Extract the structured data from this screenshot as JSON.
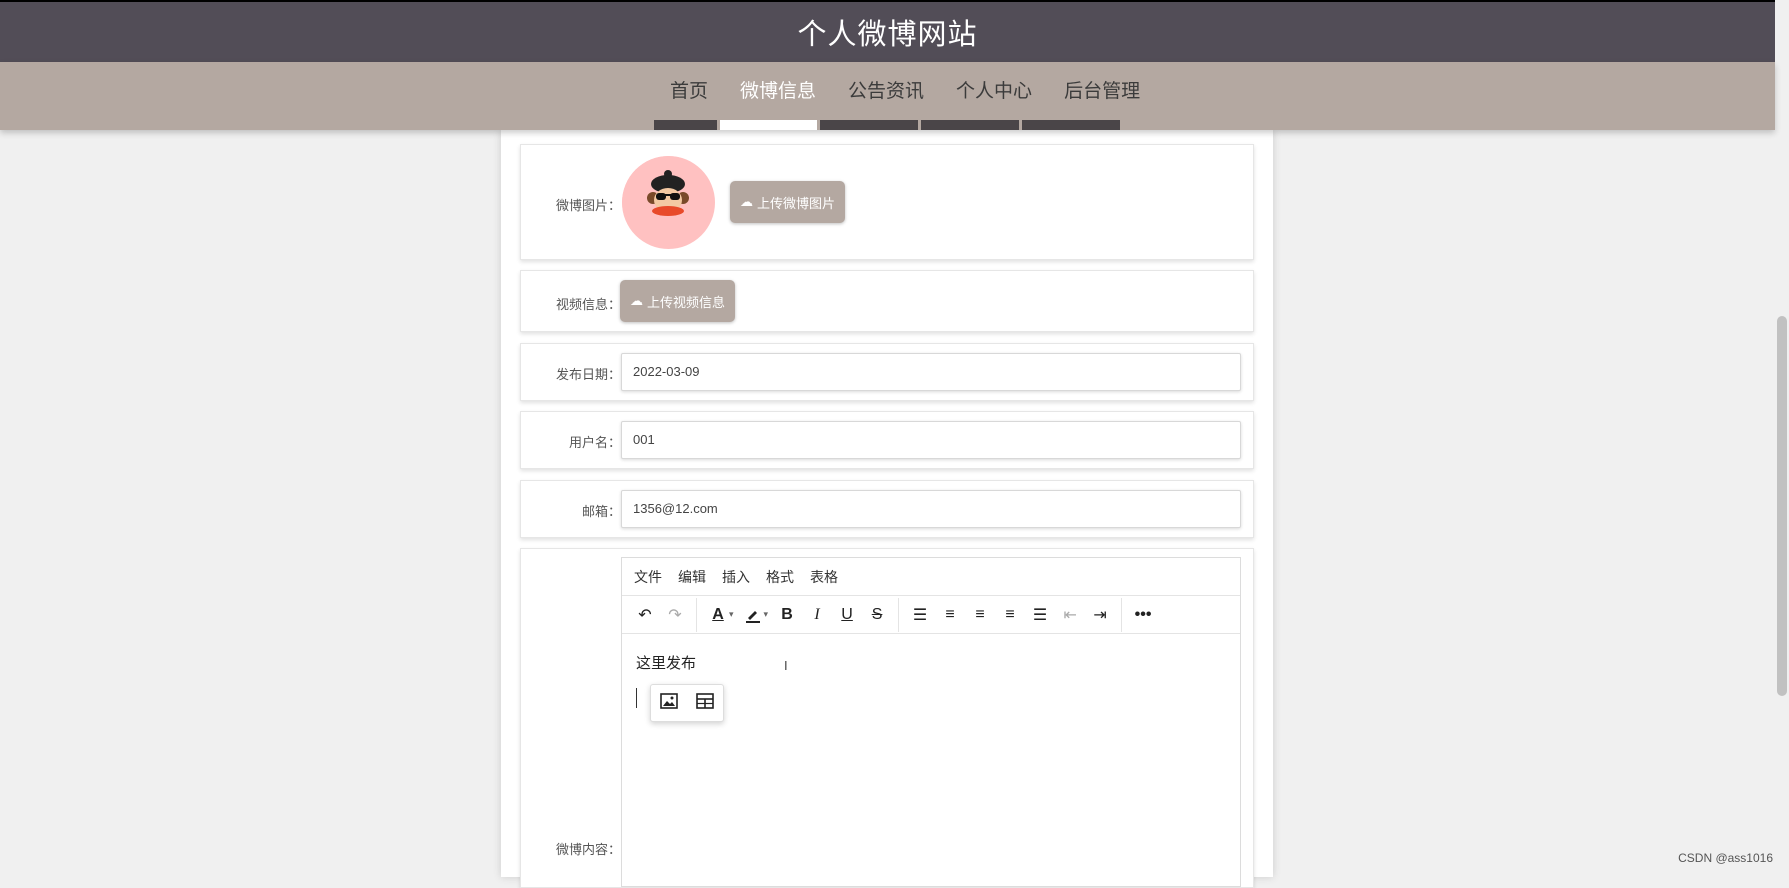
{
  "site": {
    "title": "个人微博网站"
  },
  "nav": {
    "items": [
      {
        "label": "首页"
      },
      {
        "label": "微博信息"
      },
      {
        "label": "公告资讯"
      },
      {
        "label": "个人中心"
      },
      {
        "label": "后台管理"
      }
    ],
    "active_index": 1
  },
  "form": {
    "image": {
      "label": "微博图片：",
      "upload_label": "上传微博图片"
    },
    "video": {
      "label": "视频信息：",
      "upload_label": "上传视频信息"
    },
    "publish_date": {
      "label": "发布日期：",
      "value": "2022-03-09"
    },
    "username": {
      "label": "用户名：",
      "value": "001"
    },
    "email": {
      "label": "邮箱：",
      "value": "1356@12.com"
    },
    "content": {
      "label": "微博内容：",
      "menu": [
        "文件",
        "编辑",
        "插入",
        "格式",
        "表格"
      ],
      "text": "这里发布"
    }
  },
  "toolbar_icons": [
    "undo-icon",
    "redo-icon",
    "text-color-icon",
    "highlight-icon",
    "bold-icon",
    "italic-icon",
    "underline-icon",
    "strikethrough-icon",
    "line-height-icon",
    "align-left-icon",
    "align-center-icon",
    "align-right-icon",
    "justify-icon",
    "outdent-icon",
    "indent-icon",
    "more-icon"
  ],
  "colors": {
    "header": "#524d57",
    "nav": "#b4a8a1",
    "accent": "#b4a8a1"
  },
  "watermark": "CSDN @ass1016"
}
